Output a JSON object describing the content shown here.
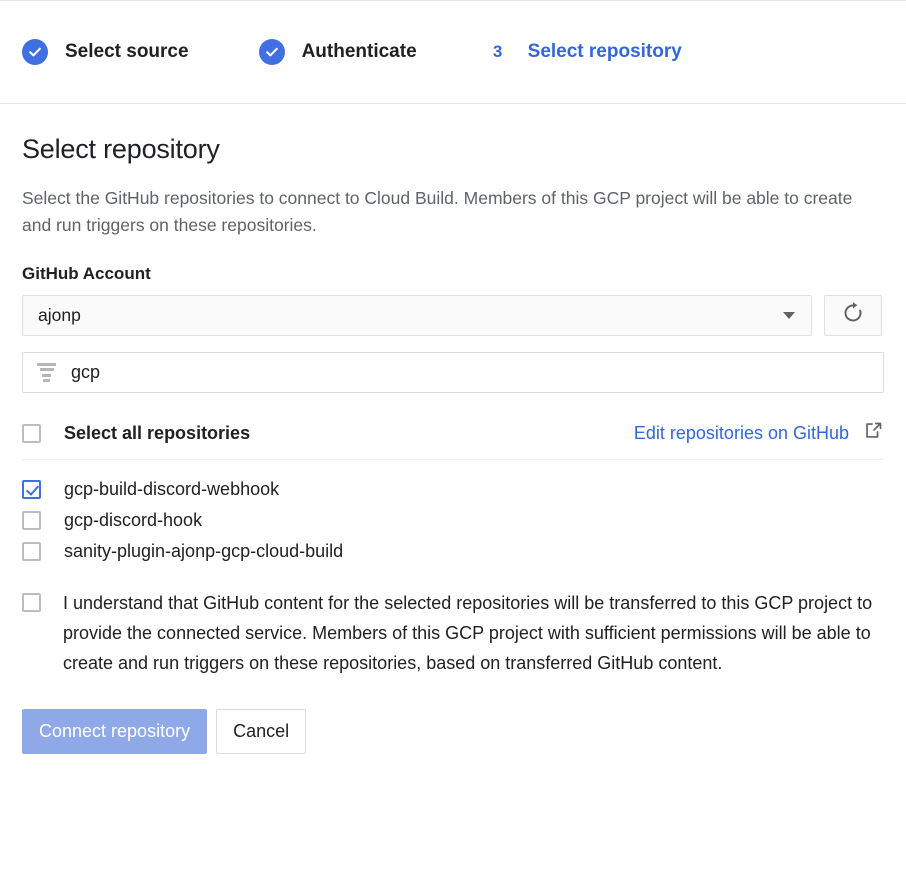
{
  "stepper": {
    "steps": [
      {
        "label": "Select source",
        "state": "done",
        "icon": "check-circle-icon",
        "number": "1"
      },
      {
        "label": "Authenticate",
        "state": "done",
        "icon": "check-circle-icon",
        "number": "2"
      },
      {
        "label": "Select repository",
        "state": "active",
        "icon": "",
        "number": "3"
      }
    ]
  },
  "main": {
    "title": "Select repository",
    "description": "Select the GitHub repositories to connect to Cloud Build. Members of this GCP project will be able to create and run triggers on these repositories.",
    "account": {
      "label": "GitHub Account",
      "selected": "ajonp",
      "caret_icon": "chevron-down-icon",
      "refresh_icon": "refresh-icon"
    },
    "filter": {
      "value": "gcp",
      "placeholder": "Filter repositories",
      "icon": "filter-icon"
    },
    "select_all": {
      "label": "Select all repositories",
      "checked": false
    },
    "edit_link": {
      "label": "Edit repositories on GitHub",
      "icon": "open-in-new-icon"
    },
    "repositories": [
      {
        "name": "gcp-build-discord-webhook",
        "checked": true
      },
      {
        "name": "gcp-discord-hook",
        "checked": false
      },
      {
        "name": "sanity-plugin-ajonp-gcp-cloud-build",
        "checked": false
      }
    ],
    "consent": {
      "checked": false,
      "text": "I understand that GitHub content for the selected repositories will be transferred to this GCP project to provide the connected service. Members of this GCP project with sufficient permissions will be able to create and run triggers on these repositories, based on transferred GitHub content."
    },
    "buttons": {
      "primary": "Connect repository",
      "secondary": "Cancel"
    }
  },
  "colors": {
    "accent_blue": "#3367d6",
    "step_done_blue": "#3f6fe0",
    "primary_button": "#8fa9e8",
    "checkbox_checked": "#3f6fe0",
    "muted_text": "#5f6368"
  }
}
